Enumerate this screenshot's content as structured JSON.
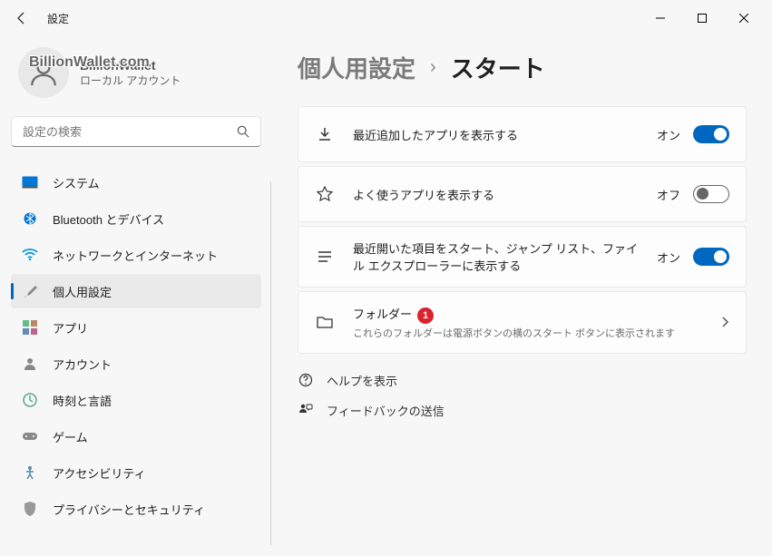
{
  "window": {
    "title": "設定"
  },
  "account": {
    "name": "BillionWallet",
    "sub": "ローカル アカウント",
    "watermark": "BillionWallet.com"
  },
  "search": {
    "placeholder": "設定の検索"
  },
  "nav": {
    "items": [
      {
        "label": "システム"
      },
      {
        "label": "Bluetooth とデバイス"
      },
      {
        "label": "ネットワークとインターネット"
      },
      {
        "label": "個人用設定"
      },
      {
        "label": "アプリ"
      },
      {
        "label": "アカウント"
      },
      {
        "label": "時刻と言語"
      },
      {
        "label": "ゲーム"
      },
      {
        "label": "アクセシビリティ"
      },
      {
        "label": "プライバシーとセキュリティ"
      }
    ]
  },
  "breadcrumb": {
    "parent": "個人用設定",
    "sep": "›",
    "current": "スタート"
  },
  "tiles": {
    "recent_apps": {
      "label": "最近追加したアプリを表示する",
      "state": "オン"
    },
    "most_used": {
      "label": "よく使うアプリを表示する",
      "state": "オフ"
    },
    "recent_items": {
      "label": "最近開いた項目をスタート、ジャンプ リスト、ファイル エクスプローラーに表示する",
      "state": "オン"
    },
    "folders": {
      "label": "フォルダー",
      "badge": "1",
      "sub": "これらのフォルダーは電源ボタンの横のスタート ボタンに表示されます"
    }
  },
  "links": {
    "help": "ヘルプを表示",
    "feedback": "フィードバックの送信"
  }
}
